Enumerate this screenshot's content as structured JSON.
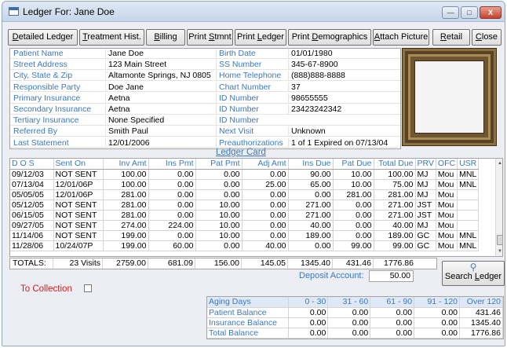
{
  "window": {
    "title": "Ledger For: Jane Doe",
    "min_label": "—",
    "max_label": "□",
    "close_label": "X"
  },
  "toolbar": [
    {
      "pre": "",
      "key": "D",
      "post": "etailed Ledger"
    },
    {
      "pre": "",
      "key": "T",
      "post": "reatment Hist."
    },
    {
      "pre": "",
      "key": "B",
      "post": "illing"
    },
    {
      "pre": "Print ",
      "key": "S",
      "post": "tmnt"
    },
    {
      "pre": "Print ",
      "key": "L",
      "post": "edger"
    },
    {
      "pre": "Print ",
      "key": "D",
      "post": "emographics"
    },
    {
      "pre": "",
      "key": "A",
      "post": "ttach Picture"
    },
    {
      "pre": "",
      "key": "R",
      "post": "etail"
    },
    {
      "pre": "",
      "key": "C",
      "post": "lose"
    }
  ],
  "patient": [
    {
      "l1": "Patient Name",
      "v1": "Jane Doe",
      "l2": "Birth Date",
      "v2": "01/01/1980"
    },
    {
      "l1": "Street Address",
      "v1": "123 Main Street",
      "l2": "SS Number",
      "v2": "345-67-8900"
    },
    {
      "l1": "City, State & Zip",
      "v1": "Altamonte Springs, NJ 0805",
      "l2": "Home Telephone",
      "v2": "(888)888-8888"
    },
    {
      "l1": "Responsible Party",
      "v1": "Doe Jane",
      "l2": "Chart Number",
      "v2": "37"
    },
    {
      "l1": "Primary Insurance",
      "v1": "Aetna",
      "l2": "ID Number",
      "v2": "98655555"
    },
    {
      "l1": "Secondary Insurance",
      "v1": "Aetna",
      "l2": "ID Number",
      "v2": "23423242342"
    },
    {
      "l1": "Tertiary Insurance",
      "v1": "None Specified",
      "l2": "ID Number",
      "v2": ""
    },
    {
      "l1": "Referred By",
      "v1": "Smith Paul",
      "l2": "Next Visit",
      "v2": "Unknown"
    },
    {
      "l1": "Last Statement",
      "v1": "12/01/2006",
      "l2": "Preauthorizations",
      "v2": "1 of 1 Expired on 07/13/04"
    }
  ],
  "ledger": {
    "title": "Ledger Card",
    "columns": [
      "D O S",
      "Sent On",
      "Inv Amt",
      "Ins Pmt",
      "Pat Pmt",
      "Adj Amt",
      "Ins Due",
      "Pat Due",
      "Total Due",
      "PRV",
      "OFC",
      "USR"
    ],
    "rows": [
      [
        "09/12/03",
        "NOT SENT",
        "100.00",
        "0.00",
        "0.00",
        "0.00",
        "90.00",
        "10.00",
        "100.00",
        "MJ",
        "Mou",
        "MNL"
      ],
      [
        "07/13/04",
        "12/01/06P",
        "100.00",
        "0.00",
        "0.00",
        "25.00",
        "65.00",
        "10.00",
        "75.00",
        "MJ",
        "Mou",
        "MNL"
      ],
      [
        "05/05/05",
        "12/01/06P",
        "281.00",
        "0.00",
        "0.00",
        "0.00",
        "0.00",
        "281.00",
        "281.00",
        "MJ",
        "Mou",
        ""
      ],
      [
        "05/12/05",
        "NOT SENT",
        "281.00",
        "0.00",
        "10.00",
        "0.00",
        "271.00",
        "0.00",
        "271.00",
        "JST",
        "Mou",
        ""
      ],
      [
        "06/15/05",
        "NOT SENT",
        "281.00",
        "0.00",
        "10.00",
        "0.00",
        "271.00",
        "0.00",
        "271.00",
        "JST",
        "Mou",
        ""
      ],
      [
        "09/27/05",
        "NOT SENT",
        "274.00",
        "224.00",
        "10.00",
        "0.00",
        "40.00",
        "0.00",
        "40.00",
        "MJ",
        "Mou",
        ""
      ],
      [
        "11/14/06",
        "NOT SENT",
        "199.00",
        "0.00",
        "10.00",
        "0.00",
        "189.00",
        "0.00",
        "189.00",
        "GC",
        "Mou",
        "MNL"
      ],
      [
        "11/28/06",
        "10/24/07P",
        "199.00",
        "60.00",
        "0.00",
        "40.00",
        "0.00",
        "99.00",
        "99.00",
        "GC",
        "Mou",
        "MNL"
      ]
    ],
    "totals": {
      "label": "TOTALS:",
      "visits": "23 Visits",
      "inv": "2759.00",
      "ins_pmt": "681.09",
      "pat_pmt": "156.00",
      "adj": "145.05",
      "ins_due": "1345.40",
      "pat_due": "431.46",
      "total_due": "1776.86"
    }
  },
  "deposit": {
    "label": "Deposit Account:",
    "value": "50.00"
  },
  "search": {
    "pre": "Search ",
    "key": "L",
    "post": "edger"
  },
  "collection": {
    "label": "To Collection"
  },
  "aging": {
    "header": [
      "Aging Days",
      "0 - 30",
      "31 - 60",
      "61 - 90",
      "91 - 120",
      "Over 120"
    ],
    "rows": [
      {
        "label": "Patient Balance",
        "vals": [
          "0.00",
          "0.00",
          "0.00",
          "0.00",
          "431.46"
        ]
      },
      {
        "label": "Insurance Balance",
        "vals": [
          "0.00",
          "0.00",
          "0.00",
          "0.00",
          "1345.40"
        ]
      },
      {
        "label": "Total Balance",
        "vals": [
          "0.00",
          "0.00",
          "0.00",
          "0.00",
          "1776.86"
        ]
      }
    ]
  }
}
